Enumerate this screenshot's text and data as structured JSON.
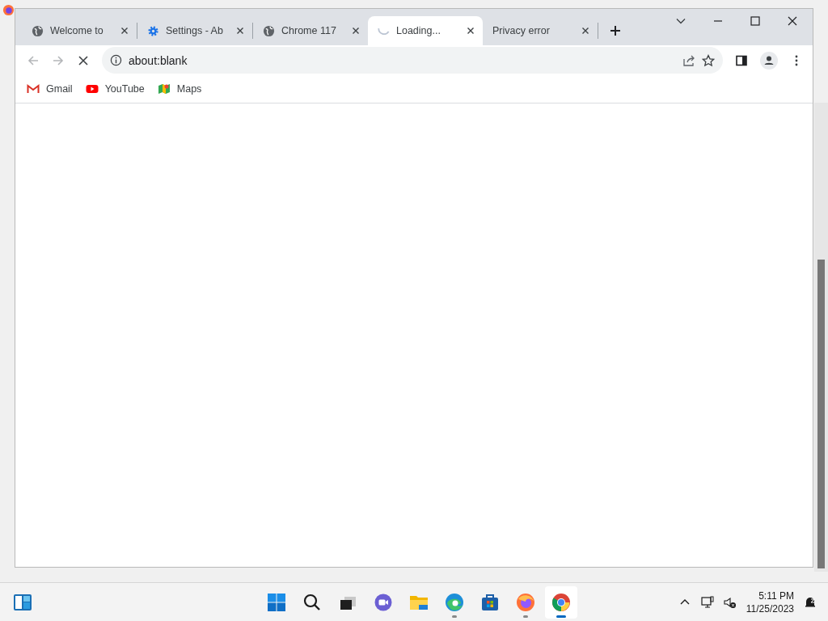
{
  "tabs": [
    {
      "title": "Welcome to",
      "kind": "globe",
      "selected": false
    },
    {
      "title": "Settings - Ab",
      "kind": "gear",
      "selected": false
    },
    {
      "title": "Chrome 117",
      "kind": "globe",
      "selected": false
    },
    {
      "title": "Loading...",
      "kind": "spinner",
      "selected": true
    },
    {
      "title": "Privacy error",
      "kind": "none",
      "selected": false
    }
  ],
  "address": {
    "value": "about:blank"
  },
  "bookmarks": [
    {
      "label": "Gmail",
      "kind": "gmail"
    },
    {
      "label": "YouTube",
      "kind": "youtube"
    },
    {
      "label": "Maps",
      "kind": "maps"
    }
  ],
  "taskbar": {
    "apps": [
      {
        "kind": "start",
        "running": false,
        "active": false
      },
      {
        "kind": "search",
        "running": false,
        "active": false
      },
      {
        "kind": "taskview",
        "running": false,
        "active": false
      },
      {
        "kind": "chat",
        "running": false,
        "active": false
      },
      {
        "kind": "folder",
        "running": false,
        "active": false
      },
      {
        "kind": "edge",
        "running": true,
        "active": false
      },
      {
        "kind": "store",
        "running": false,
        "active": false
      },
      {
        "kind": "firefox",
        "running": true,
        "active": false
      },
      {
        "kind": "chrome",
        "running": true,
        "active": true
      }
    ],
    "time": "5:11 PM",
    "date": "11/25/2023"
  }
}
